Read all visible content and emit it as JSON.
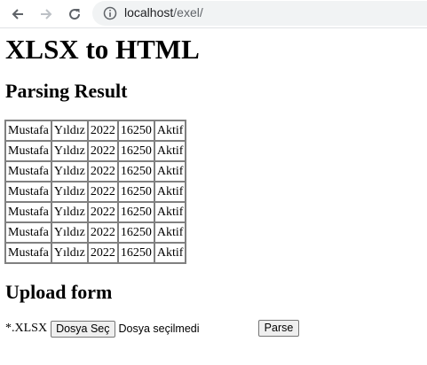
{
  "browser": {
    "url_host": "localhost",
    "url_path": "/exel/"
  },
  "page": {
    "title": "XLSX to HTML",
    "parsing_heading": "Parsing Result",
    "upload_heading": "Upload form"
  },
  "table": {
    "rows": [
      [
        "Mustafa",
        "Yıldız",
        "2022",
        "16250",
        "Aktif"
      ],
      [
        "Mustafa",
        "Yıldız",
        "2022",
        "16250",
        "Aktif"
      ],
      [
        "Mustafa",
        "Yıldız",
        "2022",
        "16250",
        "Aktif"
      ],
      [
        "Mustafa",
        "Yıldız",
        "2022",
        "16250",
        "Aktif"
      ],
      [
        "Mustafa",
        "Yıldız",
        "2022",
        "16250",
        "Aktif"
      ],
      [
        "Mustafa",
        "Yıldız",
        "2022",
        "16250",
        "Aktif"
      ],
      [
        "Mustafa",
        "Yıldız",
        "2022",
        "16250",
        "Aktif"
      ]
    ]
  },
  "upload": {
    "label": "*.XLSX",
    "file_button": "Dosya Seç",
    "file_status": "Dosya seçilmedi",
    "parse_button": "Parse"
  },
  "icons": {
    "back": "arrow-left-icon",
    "forward": "arrow-right-icon",
    "reload": "reload-icon",
    "info": "info-icon"
  }
}
